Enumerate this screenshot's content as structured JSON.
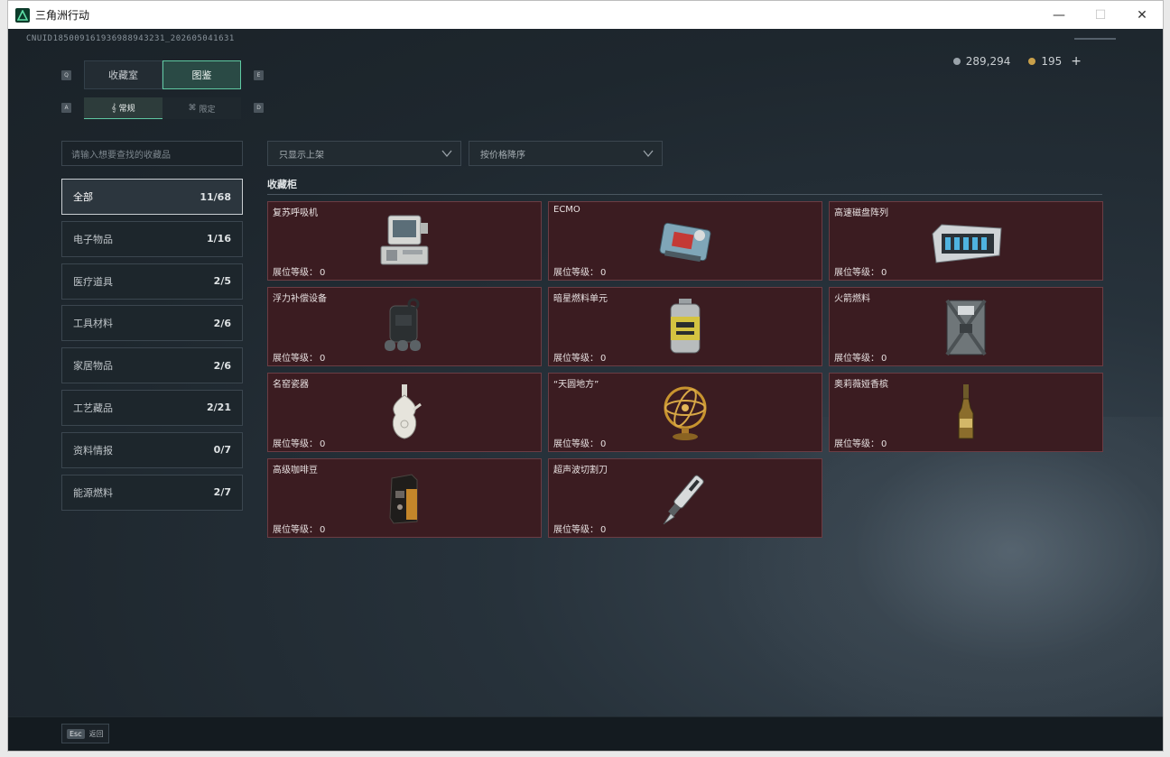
{
  "window": {
    "title": "三角洲行动",
    "minimize": "—",
    "maximize": "☐",
    "close": "✕"
  },
  "header": {
    "uid": "CNUID185009161936988943231_202605041631"
  },
  "currency": {
    "silver": "289,294",
    "gold": "195",
    "add": "+"
  },
  "main_tabs": [
    {
      "label": "收藏室",
      "key": "Q"
    },
    {
      "label": "图鉴",
      "key": "E"
    }
  ],
  "sub_tabs": [
    {
      "label": "常规",
      "key": "A"
    },
    {
      "label": "限定",
      "key": "D"
    }
  ],
  "search": {
    "placeholder": "请输入想要查找的收藏品"
  },
  "categories": [
    {
      "label": "全部",
      "count": "11/68"
    },
    {
      "label": "电子物品",
      "count": "1/16"
    },
    {
      "label": "医疗道具",
      "count": "2/5"
    },
    {
      "label": "工具材料",
      "count": "2/6"
    },
    {
      "label": "家居物品",
      "count": "2/6"
    },
    {
      "label": "工艺藏品",
      "count": "2/21"
    },
    {
      "label": "资料情报",
      "count": "0/7"
    },
    {
      "label": "能源燃料",
      "count": "2/7"
    }
  ],
  "filters": {
    "shelf": "只显示上架",
    "sort": "按价格降序"
  },
  "section_title": "收藏柜",
  "level_label": "展位等级：",
  "items": [
    {
      "name": "复苏呼吸机",
      "level": "0",
      "icon": "ventilator-icon"
    },
    {
      "name": "ECMO",
      "level": "0",
      "icon": "ecmo-icon"
    },
    {
      "name": "高速磁盘阵列",
      "level": "0",
      "icon": "disk-array-icon"
    },
    {
      "name": "浮力补偿设备",
      "level": "0",
      "icon": "buoyancy-device-icon"
    },
    {
      "name": "暗星燃料单元",
      "level": "0",
      "icon": "fuel-cell-icon"
    },
    {
      "name": "火箭燃料",
      "level": "0",
      "icon": "fuel-canister-icon"
    },
    {
      "name": "名窑瓷器",
      "level": "0",
      "icon": "porcelain-vase-icon"
    },
    {
      "name": "“天圆地方”",
      "level": "0",
      "icon": "armillary-sphere-icon"
    },
    {
      "name": "奥莉薇娅香槟",
      "level": "0",
      "icon": "champagne-bottle-icon"
    },
    {
      "name": "高级咖啡豆",
      "level": "0",
      "icon": "coffee-bag-icon"
    },
    {
      "name": "超声波切割刀",
      "level": "0",
      "icon": "ultrasonic-cutter-icon"
    }
  ],
  "bottom": {
    "esc_key": "Esc",
    "esc_label": "返回"
  },
  "colors": {
    "accent": "#5fc9a2",
    "card_bg": "#3b1c21",
    "card_border": "#6b3d44"
  }
}
